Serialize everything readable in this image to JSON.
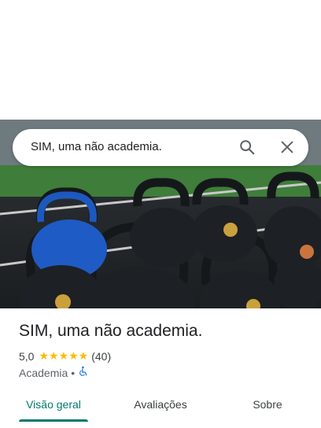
{
  "search": {
    "query": "SIM, uma não academia."
  },
  "place": {
    "name": "SIM, uma não academia.",
    "rating": "5,0",
    "stars": "★★★★★",
    "review_count": "(40)",
    "category": "Academia",
    "separator": "•",
    "accessibility_icon": "wheelchair-icon"
  },
  "tabs": [
    {
      "label": "Visão geral",
      "active": true
    },
    {
      "label": "Avaliações",
      "active": false
    },
    {
      "label": "Sobre",
      "active": false
    }
  ],
  "colors": {
    "accent": "#00796b",
    "star": "#fbbc04",
    "accessibility": "#1a73e8"
  }
}
